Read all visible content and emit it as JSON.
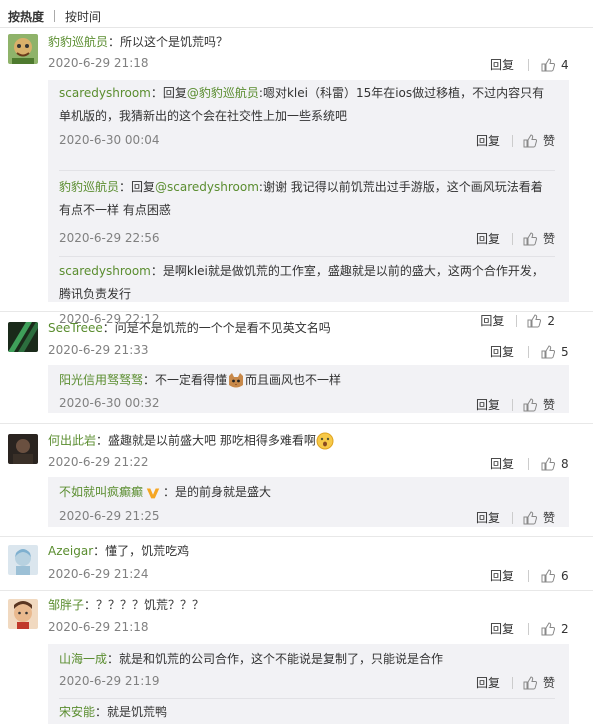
{
  "sort": {
    "hot": "按热度",
    "time": "按时间"
  },
  "comments": [
    {
      "user": "豹豹巡航员",
      "text": "：所以这个是饥荒吗？",
      "time": "2020-6-29 21:18",
      "reply": "回复",
      "likes": "4",
      "replies": [
        {
          "user": "scaredyshroom",
          "prefix": "：回复",
          "mention": "@豹豹巡航员",
          "text": ":嗯对klei（科雷）15年在ios做过移植，不过内容只有单机版的，我猜新出的这个会在社交性上加一些系统吧",
          "time": "2020-6-30 00:04",
          "reply": "回复",
          "like": "赞"
        },
        {
          "user": "豹豹巡航员",
          "prefix": "：回复",
          "mention": "@scaredyshroom",
          "text": ":谢谢 我记得以前饥荒出过手游版，这个画风玩法看着有点不一样 有点困惑",
          "time": "2020-6-29 22:56",
          "reply": "回复",
          "like": "赞"
        },
        {
          "user": "scaredyshroom",
          "text": "：是啊klei就是做饥荒的工作室，盛趣就是以前的盛大，这两个合作开发，腾讯负责发行",
          "time": "2020-6-29 22:12",
          "reply": "回复",
          "like": "2"
        }
      ]
    },
    {
      "user": "SeeTreee",
      "text": "：问是不是饥荒的一个个是看不见英文名吗",
      "time": "2020-6-29 21:33",
      "reply": "回复",
      "likes": "5",
      "replies": [
        {
          "user": "阳光信用驽驽驽",
          "text": "：不一定看得懂",
          "text2": "而且画风也不一样",
          "time": "2020-6-30 00:32",
          "reply": "回复",
          "like": "赞"
        }
      ]
    },
    {
      "user": "何出此岩",
      "text": "：盛趣就是以前盛大吧 那吃相得多难看啊",
      "time": "2020-6-29 21:22",
      "reply": "回复",
      "likes": "8",
      "replies": [
        {
          "user": "不如就叫疯癫癫",
          "text": "：是的前身就是盛大",
          "time": "2020-6-29 21:25",
          "reply": "回复",
          "like": "赞"
        }
      ]
    },
    {
      "user": "Azeigar",
      "text": "：懂了，饥荒吃鸡",
      "time": "2020-6-29 21:24",
      "reply": "回复",
      "likes": "6",
      "replies": []
    },
    {
      "user": "邹胖子",
      "text": "：？？？？饥荒？？？",
      "time": "2020-6-29 21:18",
      "reply": "回复",
      "likes": "2",
      "replies": [
        {
          "user": "山海一成",
          "text": "：就是和饥荒的公司合作，这个不能说是复制了，只能说是合作",
          "time": "2020-6-29 21:19",
          "reply": "回复",
          "like": "赞"
        },
        {
          "user": "宋安能",
          "text": "：就是饥荒鸭",
          "time": "",
          "reply": "",
          "like": ""
        }
      ]
    }
  ],
  "icons": {
    "like": "thumbs-up-icon",
    "vip": "v-badge-icon"
  },
  "colors": {
    "username": "#5a8d2f",
    "meta": "#808080",
    "reply_bg": "#f2f2f5",
    "vip": "#f5a623"
  }
}
